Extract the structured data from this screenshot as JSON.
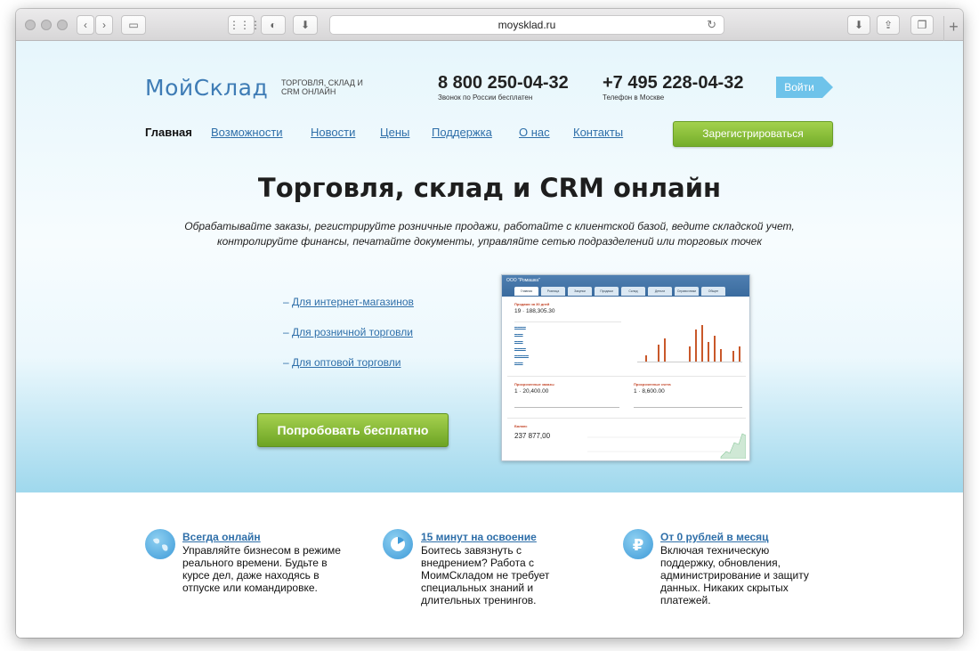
{
  "browser": {
    "url": "moysklad.ru"
  },
  "header": {
    "logo_text": "МойСклад",
    "tagline": "ТОРГОВЛЯ, СКЛАД И CRM ОНЛАЙН",
    "phones": [
      {
        "number": "8 800 250-04-32",
        "note": "Звонок по России бесплатен"
      },
      {
        "number": "+7 495 228-04-32",
        "note": "Телефон в Москве"
      }
    ],
    "login_label": "Войти"
  },
  "nav": {
    "items": [
      {
        "label": "Главная",
        "active": true
      },
      {
        "label": "Возможности",
        "active": false
      },
      {
        "label": "Новости",
        "active": false
      },
      {
        "label": "Цены",
        "active": false
      },
      {
        "label": "Поддержка",
        "active": false
      },
      {
        "label": "О нас",
        "active": false
      },
      {
        "label": "Контакты",
        "active": false
      }
    ],
    "register_label": "Зарегистрироваться"
  },
  "hero": {
    "title": "Торговля, склад и CRM онлайн",
    "subtitle_line1": "Обрабатывайте заказы, регистрируйте розничные продажи, работайте с клиентской базой, ведите складской учет,",
    "subtitle_line2": "контролируйте финансы, печатайте документы, управляйте сетью подразделений или торговых точек",
    "segment_links": [
      {
        "dash": "–",
        "label": "Для интернет-магазинов"
      },
      {
        "dash": "–",
        "label": "Для розничной торговли"
      },
      {
        "dash": "–",
        "label": "Для оптовой торговли"
      }
    ],
    "try_button": "Попробовать бесплатно"
  },
  "dashboard_preview": {
    "company": "ООО \"Ромашка\"",
    "tabs": [
      "Главная",
      "Розница",
      "Закупки",
      "Продажи",
      "Склад",
      "Деньги",
      "Справочники",
      "Общее"
    ],
    "sales_title": "Продажи за 30 дней",
    "sales_total": "19 · 188,305.30",
    "orders_title": "Просроченные заказы",
    "orders_total": "1 · 20,400.00",
    "invoices_title": "Просроченные счета",
    "invoices_total": "1 · 8,600.00",
    "balance_title": "Баланс",
    "balance_total": "237 877,00",
    "bars": [
      0,
      0.15,
      0,
      0.4,
      0.55,
      0,
      0,
      0,
      0.35,
      0.75,
      0.85,
      0.45,
      0.6,
      0.3,
      0,
      0.25,
      0.35
    ]
  },
  "features": [
    {
      "icon": "globe-icon",
      "title": "Всегда онлайн",
      "lines": [
        "Управляйте бизнесом в режиме",
        "реального времени. Будьте в",
        "курсе дел, даже находясь в",
        "отпуске или командировке."
      ]
    },
    {
      "icon": "clock-icon",
      "title": "15 минут на освоение",
      "lines": [
        "Боитесь завязнуть с",
        "внедрением? Работа с",
        "МоимСкладом не требует",
        "специальных знаний и",
        "длительных тренингов."
      ]
    },
    {
      "icon": "ruble-icon",
      "title": "От 0 рублей в месяц",
      "lines": [
        "Включая техническую",
        "поддержку, обновления,",
        "администрирование и защиту",
        "данных. Никаких скрытых",
        "платежей."
      ]
    }
  ]
}
